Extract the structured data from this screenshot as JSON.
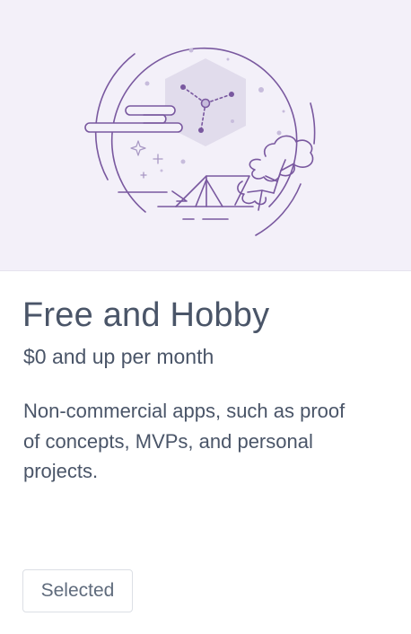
{
  "plan": {
    "name": "Free and Hobby",
    "price": "$0 and up per month",
    "description": "Non-commercial apps, such as proof of concepts, MVPs, and personal projects.",
    "button_label": "Selected",
    "illustration_icon": "camping-night-illustration"
  },
  "colors": {
    "hero_background": "#f3f0f9",
    "illustration_stroke": "#79589f",
    "text": "#4a5568",
    "button_text": "#5f6b7c",
    "button_border": "#dcdfe5"
  }
}
